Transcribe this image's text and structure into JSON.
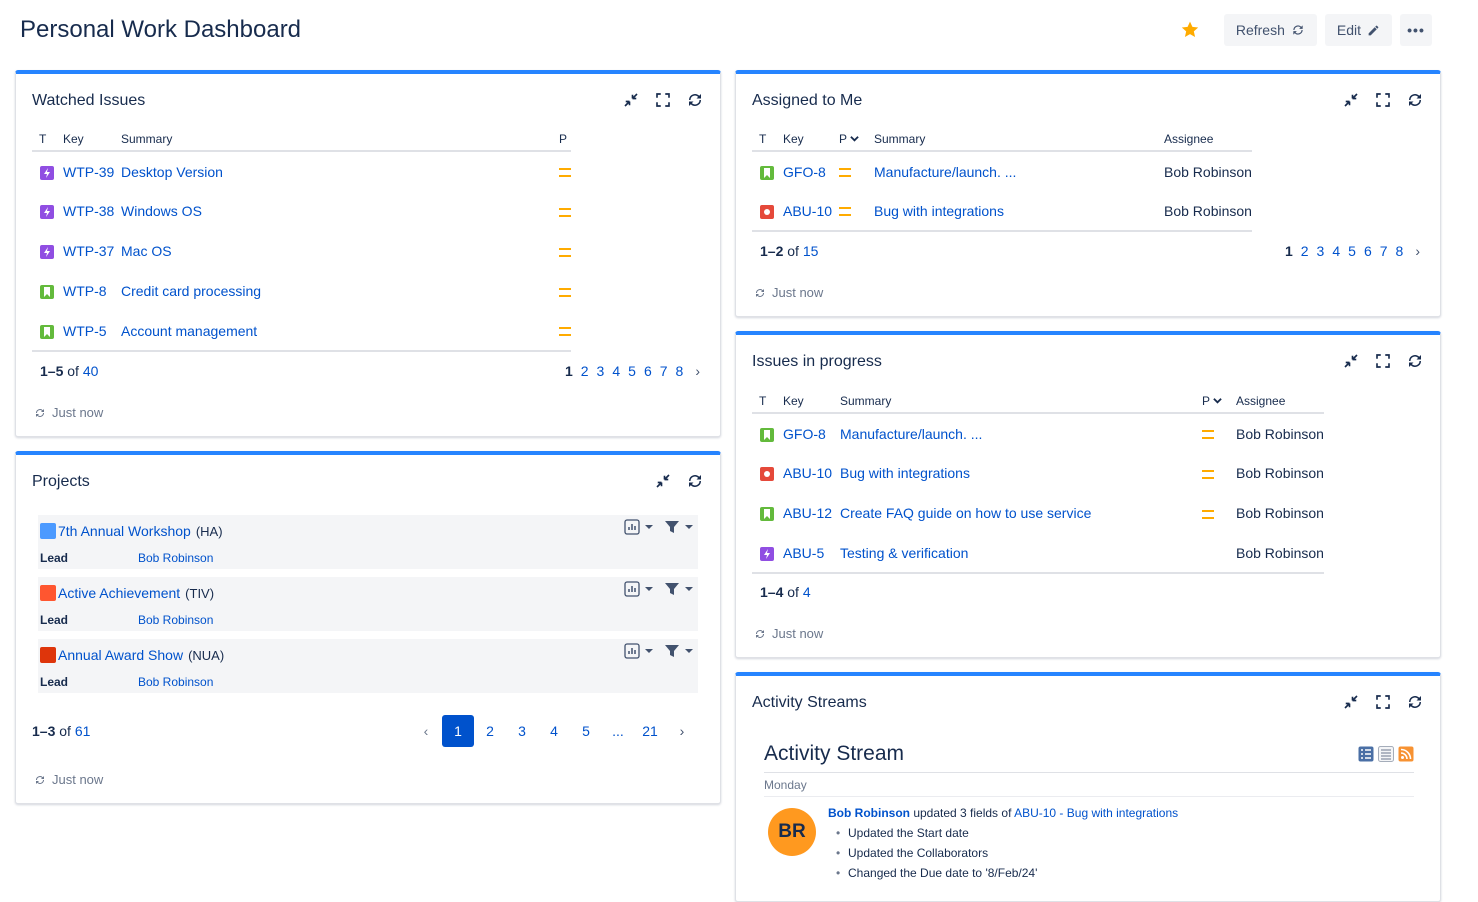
{
  "header": {
    "title": "Personal Work Dashboard",
    "refresh_label": "Refresh",
    "edit_label": "Edit",
    "more_label": "•••"
  },
  "common": {
    "updated": "Just now",
    "of": "of"
  },
  "watched": {
    "title": "Watched Issues",
    "columns": {
      "t": "T",
      "key": "Key",
      "summary": "Summary",
      "p": "P"
    },
    "rows": [
      {
        "type": "epic",
        "key": "WTP-39",
        "summary": "Desktop Version"
      },
      {
        "type": "epic",
        "key": "WTP-38",
        "summary": "Windows OS"
      },
      {
        "type": "epic",
        "key": "WTP-37",
        "summary": "Mac OS"
      },
      {
        "type": "story",
        "key": "WTP-8",
        "summary": "Credit card processing"
      },
      {
        "type": "story",
        "key": "WTP-5",
        "summary": "Account management"
      }
    ],
    "range": "1–5",
    "total": "40",
    "pages": [
      "1",
      "2",
      "3",
      "4",
      "5",
      "6",
      "7",
      "8"
    ]
  },
  "assigned": {
    "title": "Assigned to Me",
    "columns": {
      "t": "T",
      "key": "Key",
      "p": "P",
      "summary": "Summary",
      "assignee": "Assignee"
    },
    "rows": [
      {
        "type": "story",
        "key": "GFO-8",
        "summary": "Manufacture/launch. ...",
        "assignee": "Bob Robinson"
      },
      {
        "type": "bug",
        "key": "ABU-10",
        "summary": "Bug with integrations",
        "assignee": "Bob Robinson"
      }
    ],
    "range": "1–2",
    "total": "15",
    "pages": [
      "1",
      "2",
      "3",
      "4",
      "5",
      "6",
      "7",
      "8"
    ]
  },
  "progress": {
    "title": "Issues in progress",
    "columns": {
      "t": "T",
      "key": "Key",
      "summary": "Summary",
      "p": "P",
      "assignee": "Assignee"
    },
    "rows": [
      {
        "type": "story",
        "key": "GFO-8",
        "summary": "Manufacture/launch. ...",
        "assignee": "Bob Robinson",
        "prio": true
      },
      {
        "type": "bug",
        "key": "ABU-10",
        "summary": "Bug with integrations",
        "assignee": "Bob Robinson",
        "prio": true
      },
      {
        "type": "story",
        "key": "ABU-12",
        "summary": "Create FAQ guide on how to use service",
        "assignee": "Bob Robinson",
        "prio": true
      },
      {
        "type": "epic",
        "key": "ABU-5",
        "summary": "Testing & verification",
        "assignee": "Bob Robinson",
        "prio": false
      }
    ],
    "range": "1–4",
    "total": "4"
  },
  "projects": {
    "title": "Projects",
    "lead_label": "Lead",
    "items": [
      {
        "name": "7th Annual Workshop",
        "key": "(HA)",
        "lead": "Bob Robinson",
        "color": "#4c9aff"
      },
      {
        "name": "Active Achievement",
        "key": "(TIV)",
        "lead": "Bob Robinson",
        "color": "#ff5630"
      },
      {
        "name": "Annual Award Show",
        "key": "(NUA)",
        "lead": "Bob Robinson",
        "color": "#de350b"
      }
    ],
    "range": "1–3",
    "total": "61",
    "pages": [
      "1",
      "2",
      "3",
      "4",
      "5",
      "...",
      "21"
    ]
  },
  "activity": {
    "title": "Activity Streams",
    "stream_title": "Activity Stream",
    "day": "Monday",
    "avatar": "BR",
    "user": "Bob Robinson",
    "action": "updated 3 fields of",
    "issue": "ABU-10 - Bug with integrations",
    "changes": [
      "Updated the Start date",
      "Updated the Collaborators",
      "Changed the Due date to '8/Feb/24'"
    ]
  },
  "colors": {
    "accent": "#2684ff",
    "link": "#0052cc",
    "priority": "#ffab00",
    "star": "#ffab00"
  }
}
